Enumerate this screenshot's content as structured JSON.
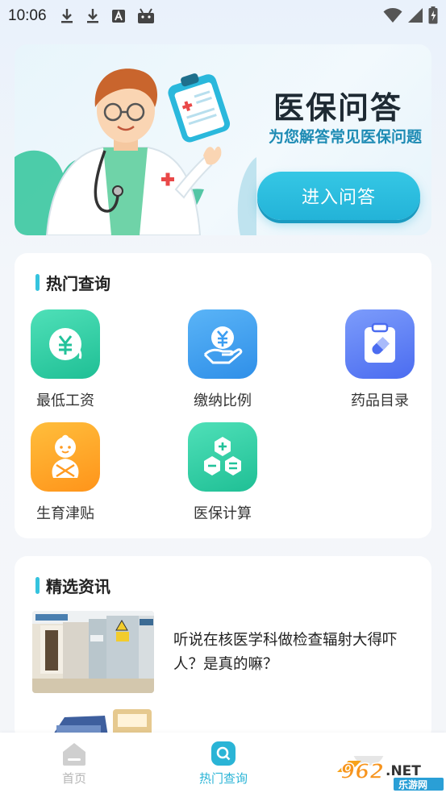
{
  "status_bar": {
    "time": "10:06",
    "left_icons": [
      "download-icon",
      "download-icon",
      "text-a-icon",
      "android-icon"
    ],
    "right_icons": [
      "wifi-icon",
      "signal-icon",
      "battery-charging-icon"
    ]
  },
  "banner": {
    "title": "医保问答",
    "subtitle": "为您解答常见医保问题",
    "button_label": "进入问答",
    "accent_color": "#2ab8dc"
  },
  "hot_query": {
    "title": "热门查询",
    "items": [
      {
        "label": "最低工资",
        "icon": "yuan-card-icon",
        "color": "#2ecfa6"
      },
      {
        "label": "缴纳比例",
        "icon": "yuan-hand-icon",
        "color": "#3c9ef2"
      },
      {
        "label": "药品目录",
        "icon": "medicine-clipboard-icon",
        "color": "#5b7ff5"
      },
      {
        "label": "生育津贴",
        "icon": "baby-icon",
        "color": "#ffa423"
      },
      {
        "label": "医保计算",
        "icon": "calculator-icon",
        "color": "#2ecfa6"
      }
    ]
  },
  "news": {
    "title": "精选资讯",
    "items": [
      {
        "title": "听说在核医学科做检查辐射大得吓人？是真的嘛？",
        "image": "hospital-corridor-photo"
      }
    ]
  },
  "bottom_nav": {
    "items": [
      {
        "label": "首页",
        "icon": "home-icon",
        "active": false
      },
      {
        "label": "热门查询",
        "icon": "search-icon",
        "active": true
      }
    ]
  },
  "watermark": {
    "text": "962.NET 乐游网"
  }
}
